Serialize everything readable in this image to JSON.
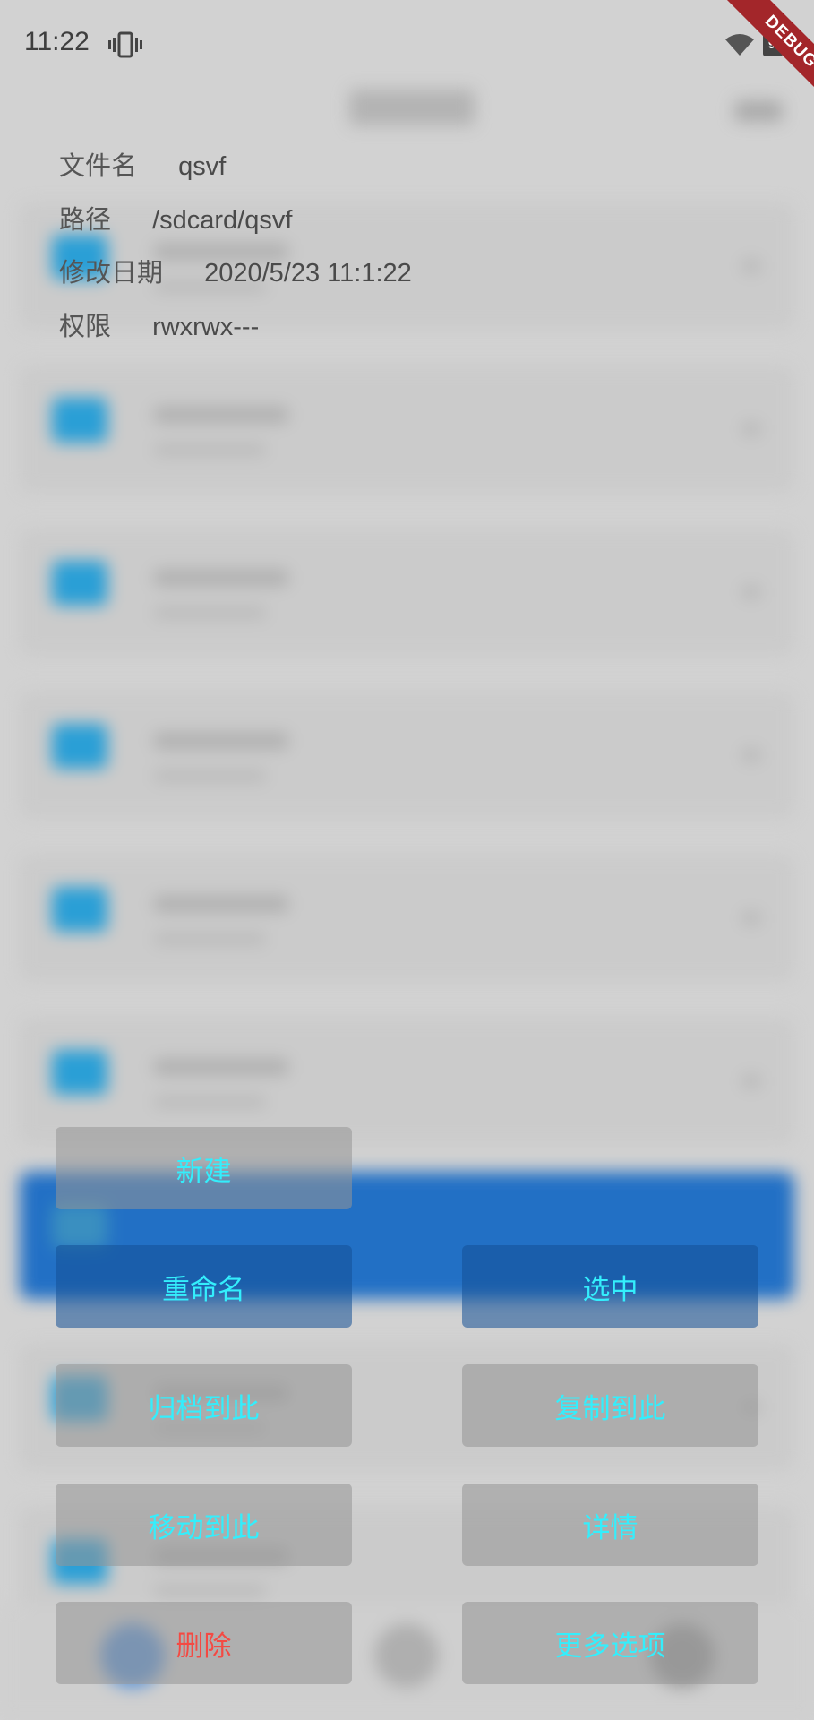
{
  "status_bar": {
    "time": "11:22",
    "vibrate_icon": "vibrate-icon",
    "wifi_icon": "wifi-icon",
    "battery_icon": "battery-icon",
    "battery_level": "96"
  },
  "debug_banner": {
    "label": "DEBUG",
    "color": "#a3262a"
  },
  "file_details": {
    "rows": [
      {
        "label": "文件名",
        "value": "qsvf"
      },
      {
        "label": "路径",
        "value": "/sdcard/qsvf"
      },
      {
        "label": "修改日期",
        "value": "2020/5/23 11:1:22"
      },
      {
        "label": "权限",
        "value": "rwxrwx---"
      }
    ]
  },
  "actions": {
    "new": "新建",
    "rename": "重命名",
    "select": "选中",
    "archive_here": "归档到此",
    "copy_here": "复制到此",
    "move_here": "移动到此",
    "details": "详情",
    "delete": "删除",
    "more_options": "更多选项"
  },
  "colors": {
    "action_text": "#34eefc",
    "delete_text": "#f44a43",
    "selected_row": "#2270c5",
    "folder_icon": "#2a9fd6"
  }
}
